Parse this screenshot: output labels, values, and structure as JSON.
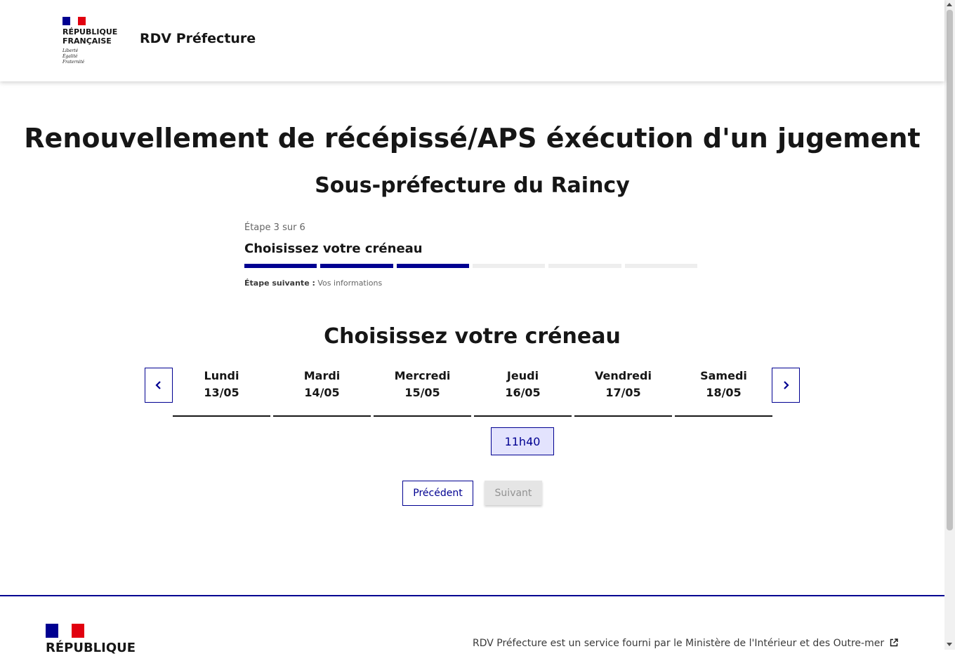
{
  "header": {
    "logo_name_line1": "RÉPUBLIQUE",
    "logo_name_line2": "FRANÇAISE",
    "motto_1": "Liberté",
    "motto_2": "Égalité",
    "motto_3": "Fraternité",
    "service_name": "RDV Préfecture"
  },
  "main": {
    "title": "Renouvellement de récépissé/APS éxécution d'un jugement",
    "subtitle": "Sous-préfecture du Raincy"
  },
  "stepper": {
    "state": "Étape 3 sur 6",
    "current_step_title": "Choisissez votre créneau",
    "current": 3,
    "total": 6,
    "next_label": "Étape suivante :",
    "next_value": "Vos informations"
  },
  "calendar": {
    "section_title": "Choisissez votre créneau",
    "prev_icon": "chevron-left-icon",
    "next_icon": "chevron-right-icon",
    "days": [
      {
        "name": "Lundi",
        "date": "13/05"
      },
      {
        "name": "Mardi",
        "date": "14/05"
      },
      {
        "name": "Mercredi",
        "date": "15/05"
      },
      {
        "name": "Jeudi",
        "date": "16/05"
      },
      {
        "name": "Vendredi",
        "date": "17/05"
      },
      {
        "name": "Samedi",
        "date": "18/05"
      }
    ],
    "slots": [
      {
        "day": "Jeudi",
        "time": "11h40"
      }
    ]
  },
  "actions": {
    "previous_label": "Précédent",
    "next_label": "Suivant"
  },
  "footer": {
    "logo_name_line1": "RÉPUBLIQUE",
    "description": "RDV Préfecture est un service fourni par le Ministère de l'Intérieur et des Outre-mer",
    "link_icon": "external-link-icon"
  },
  "colors": {
    "primary": "#000091",
    "slot_bg": "#e3e3fd",
    "marianne_red": "#e1000f",
    "disabled_bg": "#e5e5e5"
  }
}
